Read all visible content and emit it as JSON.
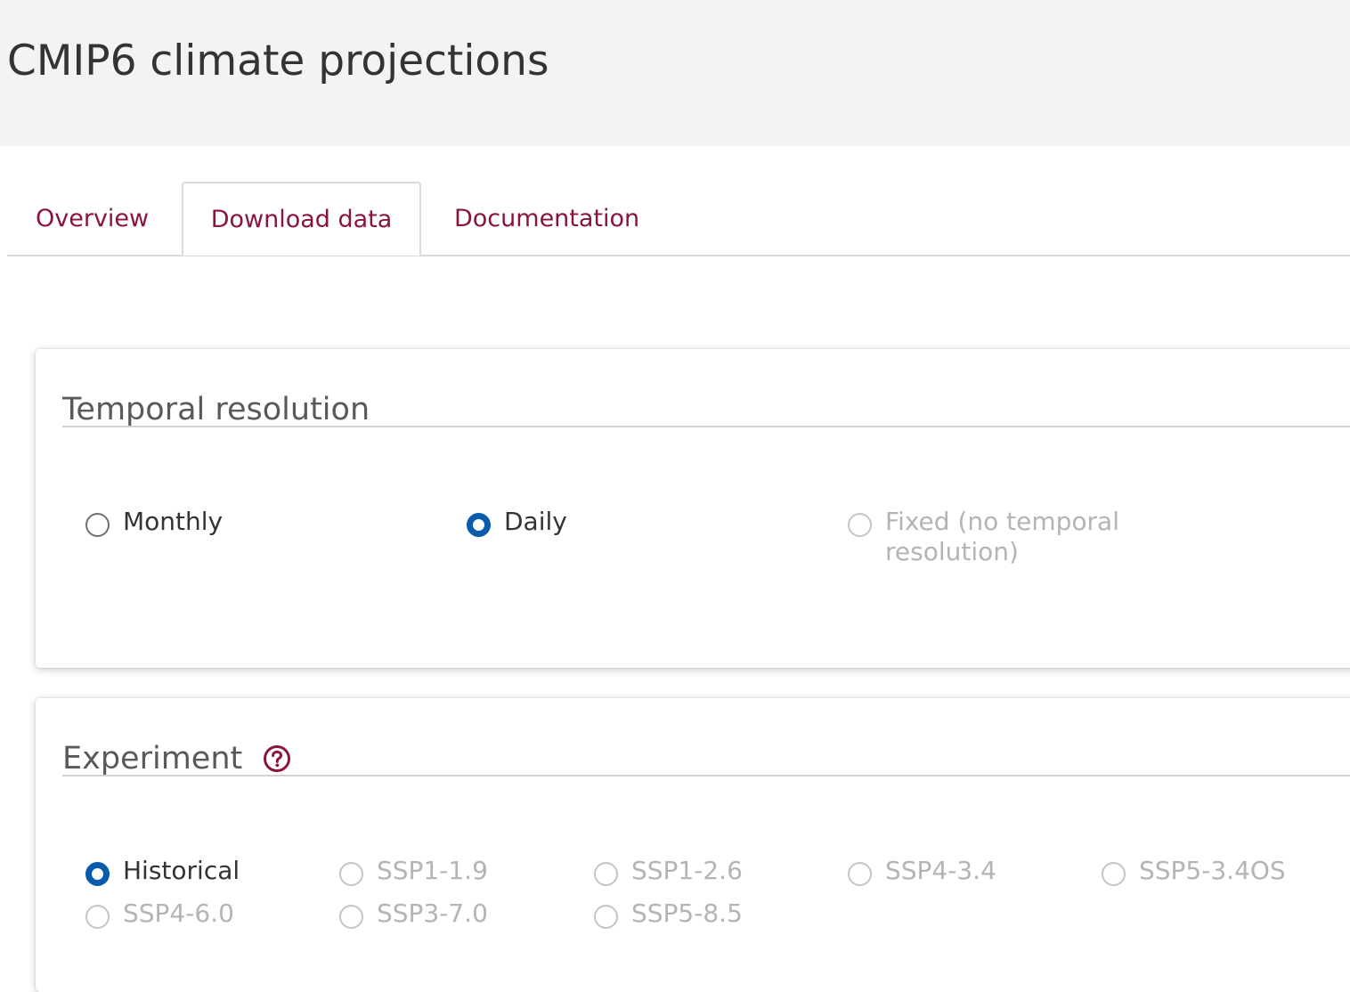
{
  "page": {
    "title": "CMIP6 climate projections"
  },
  "tabs": [
    {
      "label": "Overview",
      "active": false
    },
    {
      "label": "Download data",
      "active": true
    },
    {
      "label": "Documentation",
      "active": false
    }
  ],
  "temporal_resolution": {
    "title": "Temporal resolution",
    "options": [
      {
        "label": "Monthly",
        "checked": false,
        "disabled": false
      },
      {
        "label": "Daily",
        "checked": true,
        "disabled": false
      },
      {
        "label_line1": "Fixed (no temporal",
        "label_line2": "resolution)",
        "checked": false,
        "disabled": true
      }
    ]
  },
  "experiment": {
    "title": "Experiment",
    "help_icon": "question-circle-icon",
    "options": [
      {
        "label": "Historical",
        "checked": true,
        "disabled": false
      },
      {
        "label": "SSP1-1.9",
        "checked": false,
        "disabled": true
      },
      {
        "label": "SSP1-2.6",
        "checked": false,
        "disabled": true
      },
      {
        "label": "SSP4-3.4",
        "checked": false,
        "disabled": true
      },
      {
        "label": "SSP5-3.4OS",
        "checked": false,
        "disabled": true
      },
      {
        "label": "SSP4-6.0",
        "checked": false,
        "disabled": true
      },
      {
        "label": "SSP3-7.0",
        "checked": false,
        "disabled": true
      },
      {
        "label": "SSP5-8.5",
        "checked": false,
        "disabled": true
      }
    ]
  },
  "colors": {
    "accent": "#8a1538",
    "radio_selected": "#0a5bab",
    "header_bg": "#f3f3f3"
  }
}
